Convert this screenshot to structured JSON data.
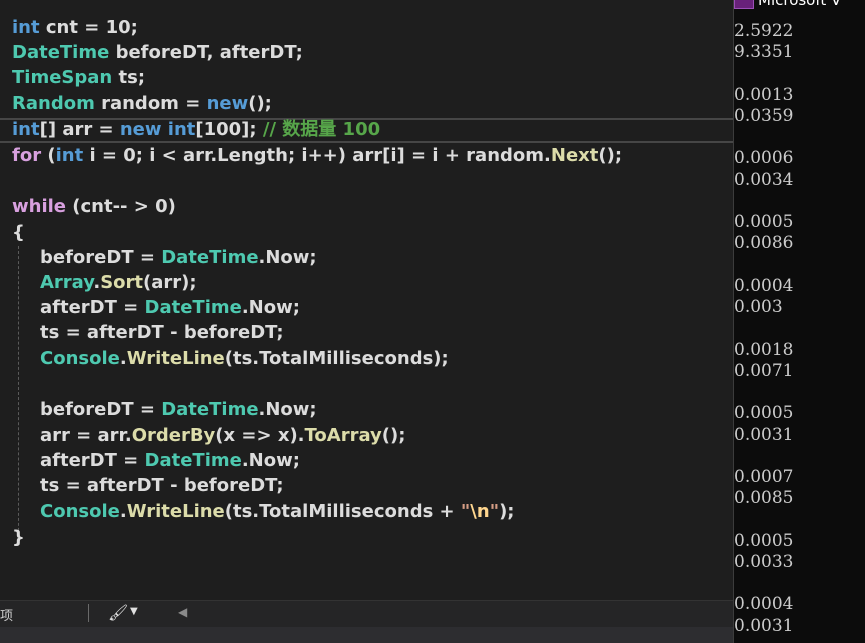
{
  "editor": {
    "code": {
      "line1": [
        "int",
        " cnt = 10;"
      ],
      "line2": [
        "DateTime",
        " beforeDT, afterDT;"
      ],
      "line3": [
        "TimeSpan",
        " ts;"
      ],
      "line4": [
        "Random",
        " random = ",
        "new",
        "();"
      ],
      "line5": [
        "int",
        "[] arr = ",
        "new",
        " ",
        "int",
        "[100]; ",
        "// 数据量 100"
      ],
      "line6": [
        "for",
        " (",
        "int",
        " i = 0; i < arr.Length; i++) arr[i] = i + random.",
        "Next",
        "();"
      ],
      "line8": [
        "while",
        " (cnt-- > 0)"
      ],
      "line9": [
        "{"
      ],
      "line10": [
        "beforeDT = ",
        "DateTime",
        ".Now;"
      ],
      "line11": [
        "Array",
        ".",
        "Sort",
        "(arr);"
      ],
      "line12": [
        "afterDT = ",
        "DateTime",
        ".Now;"
      ],
      "line13": [
        "ts = afterDT - beforeDT;"
      ],
      "line14": [
        "Console",
        ".",
        "WriteLine",
        "(ts.TotalMilliseconds);"
      ],
      "line16": [
        "beforeDT = ",
        "DateTime",
        ".Now;"
      ],
      "line17": [
        "arr = arr.",
        "OrderBy",
        "(x => x).",
        "ToArray",
        "();"
      ],
      "line18": [
        "afterDT = ",
        "DateTime",
        ".Now;"
      ],
      "line19": [
        "ts = afterDT - beforeDT;"
      ],
      "line20": [
        "Console",
        ".",
        "WriteLine",
        "(ts.TotalMilliseconds + ",
        "\"",
        "\\n",
        "\"",
        ");"
      ],
      "line21": [
        "}"
      ]
    }
  },
  "statusbar": {
    "label": "项",
    "brush_icon": "brush-icon",
    "dropdown_icon": "dropdown-arrow-icon",
    "scroll_icon": "scroll-left-icon"
  },
  "console": {
    "title": "Microsoft V",
    "output": [
      "2.5922",
      "9.3351",
      "0.0013",
      "0.0359",
      "0.0006",
      "0.0034",
      "0.0005",
      "0.0086",
      "0.0004",
      "0.003",
      "0.0018",
      "0.0071",
      "0.0005",
      "0.0031",
      "0.0007",
      "0.0085",
      "0.0005",
      "0.0033",
      "0.0004",
      "0.0031"
    ]
  },
  "colors": {
    "keyword": "#569cd6",
    "control": "#d8a0df",
    "type": "#4ec9b0",
    "method": "#dcdcaa",
    "comment": "#57a64a",
    "string": "#d69d85",
    "escape": "#ffd68f",
    "plain": "#dcdcdc"
  }
}
